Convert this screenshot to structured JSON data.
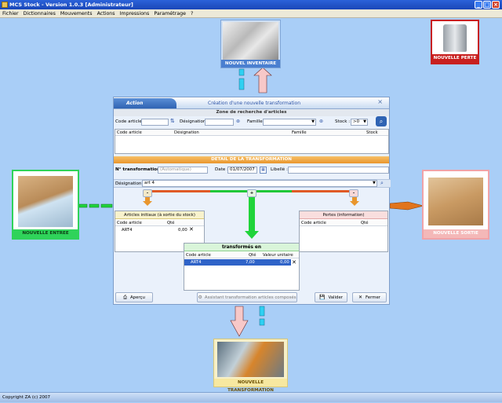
{
  "window": {
    "title": "MCS Stock - Version 1.0.3 [Administrateur]"
  },
  "menu": [
    "Fichier",
    "Dictionnaires",
    "Mouvements",
    "Actions",
    "Impressions",
    "Paramétrage",
    "?"
  ],
  "tiles": {
    "inventaire": "NOUVEL INVENTAIRE",
    "perte": "NOUVELLE PERTE",
    "entree": "NOUVELLE ENTREE",
    "sortie": "NOUVELLE SORTIE",
    "transformation": "NOUVELLE TRANSFORMATION"
  },
  "dialog": {
    "tab": "Action",
    "heading": "Création d'une nouvelle transformation",
    "close": "×",
    "search": {
      "title": "Zone de recherche d'articles",
      "code_label": "Code article :",
      "designation_label": "Désignation :",
      "famille_label": "Famille :",
      "stock_label": "Stock :",
      "stock_value": ">0",
      "columns": [
        "Code article",
        "Désignation",
        "Famille",
        "Stock"
      ]
    },
    "detail": {
      "title": "DETAIL DE LA TRANSFORMATION",
      "numero_label": "N° transformation :",
      "numero_placeholder": "(Automatique)",
      "date_label": "Date :",
      "date_value": "01/07/2007",
      "libelle_label": "Libellé :",
      "designation_label": "Désignation :",
      "designation_value": "art 4"
    },
    "controls": {
      "minus_left": "-",
      "plus": "+",
      "minus_right": "-"
    },
    "initial_panel": {
      "title": "Articles initiaux (à sortie du stock)",
      "columns": [
        "Code article",
        "Qté"
      ],
      "rows": [
        {
          "code": "ART4",
          "qte": "0,00"
        }
      ]
    },
    "loss_panel": {
      "title": "Pertes (information)",
      "columns": [
        "Code article",
        "Qté"
      ]
    },
    "transformed": {
      "title": "transformés en",
      "columns": [
        "Code article",
        "Qté",
        "Valeur unitaire HT"
      ],
      "rows": [
        {
          "code": "ART4",
          "qte": "7,00",
          "valeur": "0,00"
        }
      ]
    },
    "buttons": {
      "apercu": "Aperçu",
      "assistant": "Assistant transformation articles composés",
      "valider": "Valider",
      "fermer": "Fermer"
    }
  },
  "statusbar": "Copyright ZA (c) 2007",
  "colors": {
    "accent_orange": "#f0a030",
    "green": "#1fd43a",
    "pink": "#f4b8b8",
    "title_blue": "#1a47b8"
  }
}
